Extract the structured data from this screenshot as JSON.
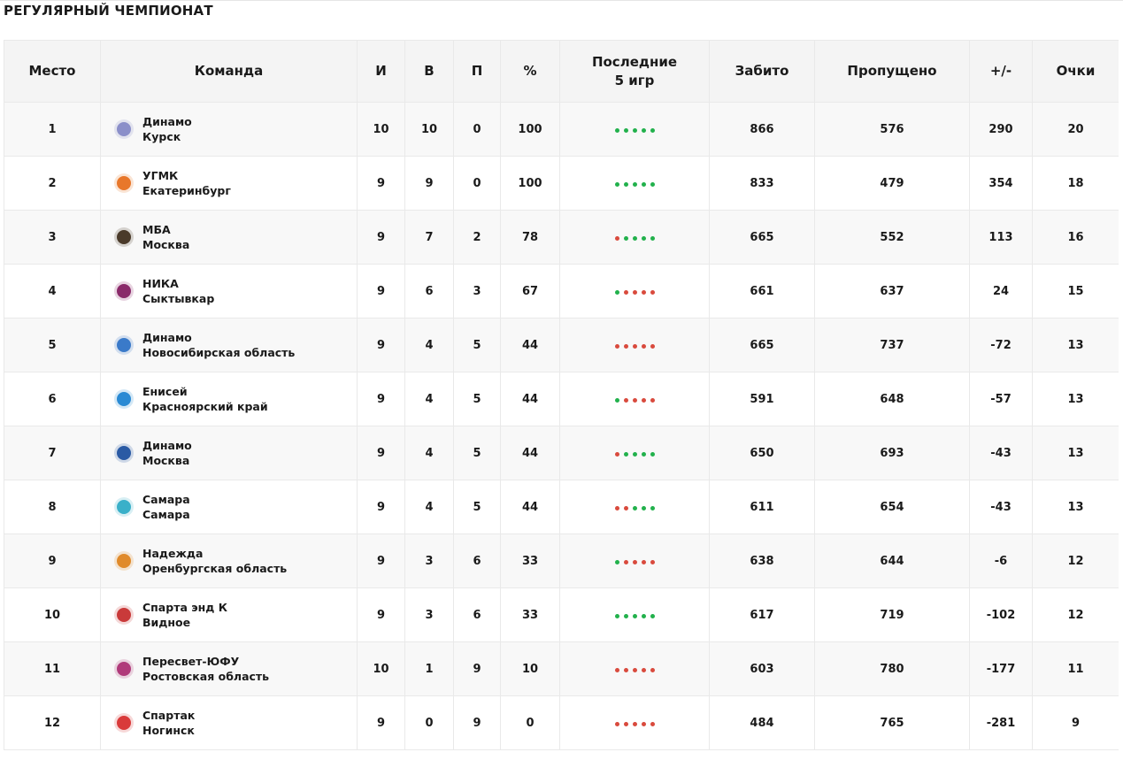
{
  "title": "РЕГУЛЯРНЫЙ ЧЕМПИОНАТ",
  "headers": {
    "place": "Место",
    "team": "Команда",
    "games": "И",
    "wins": "В",
    "losses": "П",
    "pct": "%",
    "last5_line1": "Последние",
    "last5_line2": "5 игр",
    "scored": "Забито",
    "conceded": "Пропущено",
    "diff": "+/-",
    "points": "Очки"
  },
  "colors": {
    "win": "#22b14c",
    "loss": "#d94a3d"
  },
  "rows": [
    {
      "place": "1",
      "name": "Динамо",
      "city": "Курск",
      "logo": "dinamo-kursk-logo",
      "logo_color": "#8b8fc9",
      "g": "10",
      "w": "10",
      "l": "0",
      "pct": "100",
      "last5": [
        "W",
        "W",
        "W",
        "W",
        "W"
      ],
      "scored": "866",
      "conceded": "576",
      "diff": "290",
      "points": "20"
    },
    {
      "place": "2",
      "name": "УГМК",
      "city": "Екатеринбург",
      "logo": "ugmk-logo",
      "logo_color": "#e8772a",
      "g": "9",
      "w": "9",
      "l": "0",
      "pct": "100",
      "last5": [
        "W",
        "W",
        "W",
        "W",
        "W"
      ],
      "scored": "833",
      "conceded": "479",
      "diff": "354",
      "points": "18"
    },
    {
      "place": "3",
      "name": "МБА",
      "city": "Москва",
      "logo": "mba-logo",
      "logo_color": "#4a3a2a",
      "g": "9",
      "w": "7",
      "l": "2",
      "pct": "78",
      "last5": [
        "L",
        "W",
        "W",
        "W",
        "W"
      ],
      "scored": "665",
      "conceded": "552",
      "diff": "113",
      "points": "16"
    },
    {
      "place": "4",
      "name": "НИКА",
      "city": "Сыктывкар",
      "logo": "nika-logo",
      "logo_color": "#8a2a6a",
      "g": "9",
      "w": "6",
      "l": "3",
      "pct": "67",
      "last5": [
        "W",
        "L",
        "L",
        "L",
        "L"
      ],
      "scored": "661",
      "conceded": "637",
      "diff": "24",
      "points": "15"
    },
    {
      "place": "5",
      "name": "Динамо",
      "city": "Новосибирская область",
      "logo": "dinamo-novosibirsk-logo",
      "logo_color": "#3a7ac9",
      "g": "9",
      "w": "4",
      "l": "5",
      "pct": "44",
      "last5": [
        "L",
        "L",
        "L",
        "L",
        "L"
      ],
      "scored": "665",
      "conceded": "737",
      "diff": "-72",
      "points": "13"
    },
    {
      "place": "6",
      "name": "Енисей",
      "city": "Красноярский край",
      "logo": "enisey-logo",
      "logo_color": "#2a8ad4",
      "g": "9",
      "w": "4",
      "l": "5",
      "pct": "44",
      "last5": [
        "W",
        "L",
        "L",
        "L",
        "L"
      ],
      "scored": "591",
      "conceded": "648",
      "diff": "-57",
      "points": "13"
    },
    {
      "place": "7",
      "name": "Динамо",
      "city": "Москва",
      "logo": "dinamo-moscow-logo",
      "logo_color": "#2a5aa4",
      "g": "9",
      "w": "4",
      "l": "5",
      "pct": "44",
      "last5": [
        "L",
        "W",
        "W",
        "W",
        "W"
      ],
      "scored": "650",
      "conceded": "693",
      "diff": "-43",
      "points": "13"
    },
    {
      "place": "8",
      "name": "Самара",
      "city": "Самара",
      "logo": "samara-logo",
      "logo_color": "#3ab0c9",
      "g": "9",
      "w": "4",
      "l": "5",
      "pct": "44",
      "last5": [
        "L",
        "L",
        "W",
        "W",
        "W"
      ],
      "scored": "611",
      "conceded": "654",
      "diff": "-43",
      "points": "13"
    },
    {
      "place": "9",
      "name": "Надежда",
      "city": "Оренбургская область",
      "logo": "nadezhda-logo",
      "logo_color": "#e08a2a",
      "g": "9",
      "w": "3",
      "l": "6",
      "pct": "33",
      "last5": [
        "W",
        "L",
        "L",
        "L",
        "L"
      ],
      "scored": "638",
      "conceded": "644",
      "diff": "-6",
      "points": "12"
    },
    {
      "place": "10",
      "name": "Спарта энд К",
      "city": "Видное",
      "logo": "sparta-logo",
      "logo_color": "#c93a3a",
      "g": "9",
      "w": "3",
      "l": "6",
      "pct": "33",
      "last5": [
        "W",
        "W",
        "W",
        "W",
        "W"
      ],
      "scored": "617",
      "conceded": "719",
      "diff": "-102",
      "points": "12"
    },
    {
      "place": "11",
      "name": "Пересвет-ЮФУ",
      "city": "Ростовская область",
      "logo": "peresvet-logo",
      "logo_color": "#b03a7a",
      "g": "10",
      "w": "1",
      "l": "9",
      "pct": "10",
      "last5": [
        "L",
        "L",
        "L",
        "L",
        "L"
      ],
      "scored": "603",
      "conceded": "780",
      "diff": "-177",
      "points": "11"
    },
    {
      "place": "12",
      "name": "Спартак",
      "city": "Ногинск",
      "logo": "spartak-logo",
      "logo_color": "#d93a3a",
      "g": "9",
      "w": "0",
      "l": "9",
      "pct": "0",
      "last5": [
        "L",
        "L",
        "L",
        "L",
        "L"
      ],
      "scored": "484",
      "conceded": "765",
      "diff": "-281",
      "points": "9"
    }
  ]
}
